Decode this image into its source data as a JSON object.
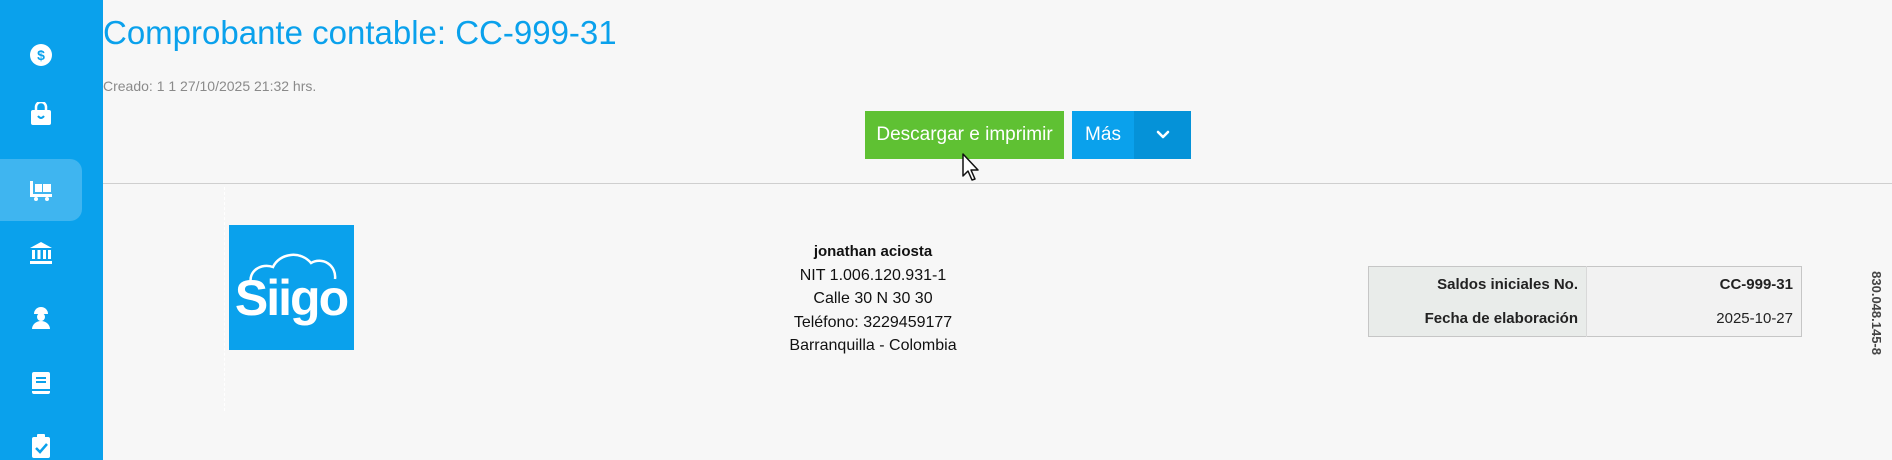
{
  "sidebar": {
    "items": [
      {
        "icon": "dollar-coin-icon",
        "active": false
      },
      {
        "icon": "shopping-bag-icon",
        "active": false
      },
      {
        "icon": "truck-delivery-icon",
        "active": true
      },
      {
        "icon": "bank-icon",
        "active": false
      },
      {
        "icon": "worker-icon",
        "active": false
      },
      {
        "icon": "book-icon",
        "active": false
      },
      {
        "icon": "clipboard-check-icon",
        "active": false
      }
    ],
    "color": "#0aa1ec"
  },
  "header": {
    "title": "Comprobante contable: CC-999-31",
    "created": "Creado: 1 1 27/10/2025 21:32 hrs."
  },
  "actions": {
    "download_label": "Descargar e imprimir",
    "more_label": "Más",
    "download_color": "#5fc133",
    "more_color": "#0aa1ec"
  },
  "document": {
    "logo_text": "Siigo",
    "company": {
      "name": "jonathan aciosta",
      "nit": "NIT 1.006.120.931-1",
      "address": "Calle 30 N 30 30",
      "phone": "Teléfono: 3229459177",
      "city": "Barranquilla - Colombia"
    },
    "info": {
      "rows": [
        {
          "label": "Saldos iniciales No.",
          "value": "CC-999-31"
        },
        {
          "label": "Fecha de elaboración",
          "value": "2025-10-27"
        }
      ]
    },
    "side_text": "830.048.145-8"
  }
}
